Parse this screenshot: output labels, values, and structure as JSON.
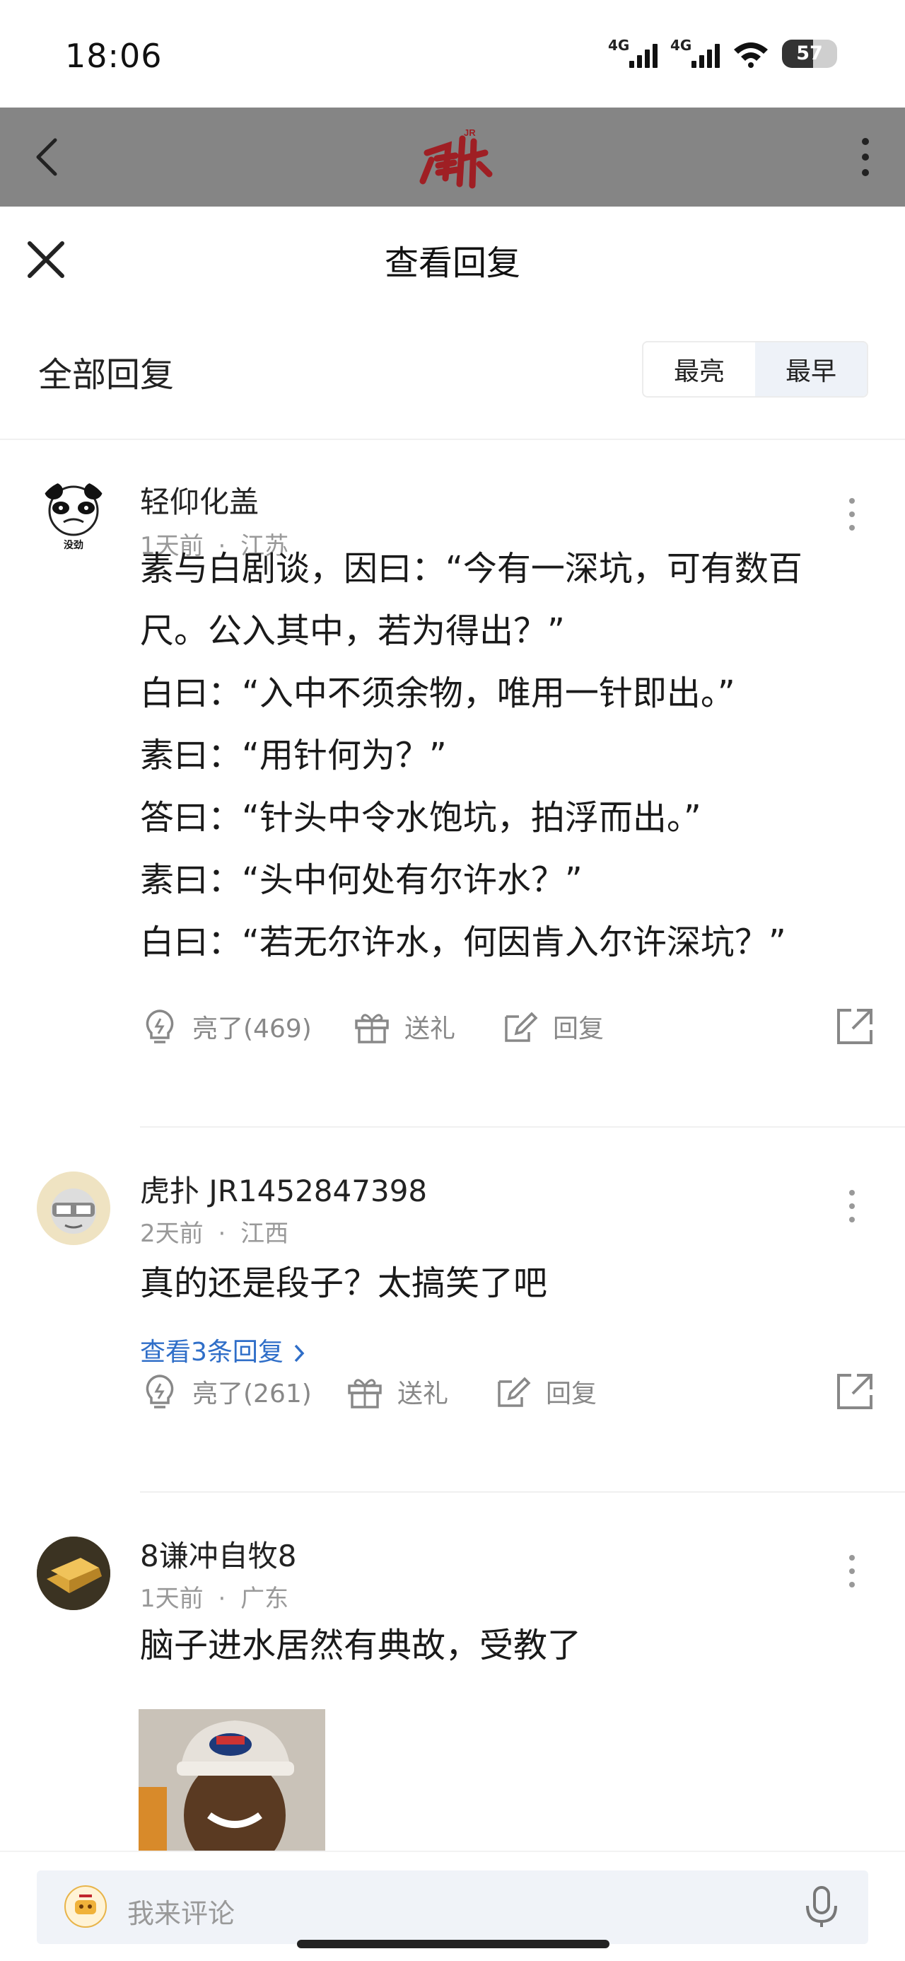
{
  "status": {
    "time": "18:06",
    "network1": "4G",
    "network2": "4G",
    "battery": "57",
    "battery_level": 0.57
  },
  "sheet": {
    "title": "查看回复"
  },
  "section": {
    "title": "全部回复",
    "sort_options": [
      "最亮",
      "最早"
    ],
    "active_sort": "最早"
  },
  "comments": [
    {
      "name": "轻仰化盖",
      "time": "1天前",
      "location": "江苏",
      "body_lines": [
        "素与白剧谈，因曰：“今有一深坑，可有数百",
        "尺。公入其中，若为得出？”",
        "白曰：“入中不须余物，唯用一针即出。”",
        "素曰：“用针何为？”",
        "答曰：“针头中令水饱坑，拍浮而出。”",
        "素曰：“头中何处有尔许水？”",
        "白曰：“若无尔许水，何因肯入尔许深坑？”"
      ],
      "avatar_caption": "没劲",
      "like_label": "亮了(469)",
      "gift_label": "送礼",
      "reply_label": "回复"
    },
    {
      "name": "虎扑 JR1452847398",
      "time": "2天前",
      "location": "江西",
      "body_lines": [
        "真的还是段子？太搞笑了吧"
      ],
      "view_replies": "查看3条回复",
      "like_label": "亮了(261)",
      "gift_label": "送礼",
      "reply_label": "回复"
    },
    {
      "name": "8谦冲自牧8",
      "time": "1天前",
      "location": "广东",
      "body_lines": [
        "脑子进水居然有典故，受教了"
      ]
    }
  ],
  "comment_bar": {
    "placeholder": "我来评论"
  },
  "colors": {
    "link": "#2f6ec8",
    "brand_red": "#c0272d",
    "dim_bar": "#858585"
  }
}
